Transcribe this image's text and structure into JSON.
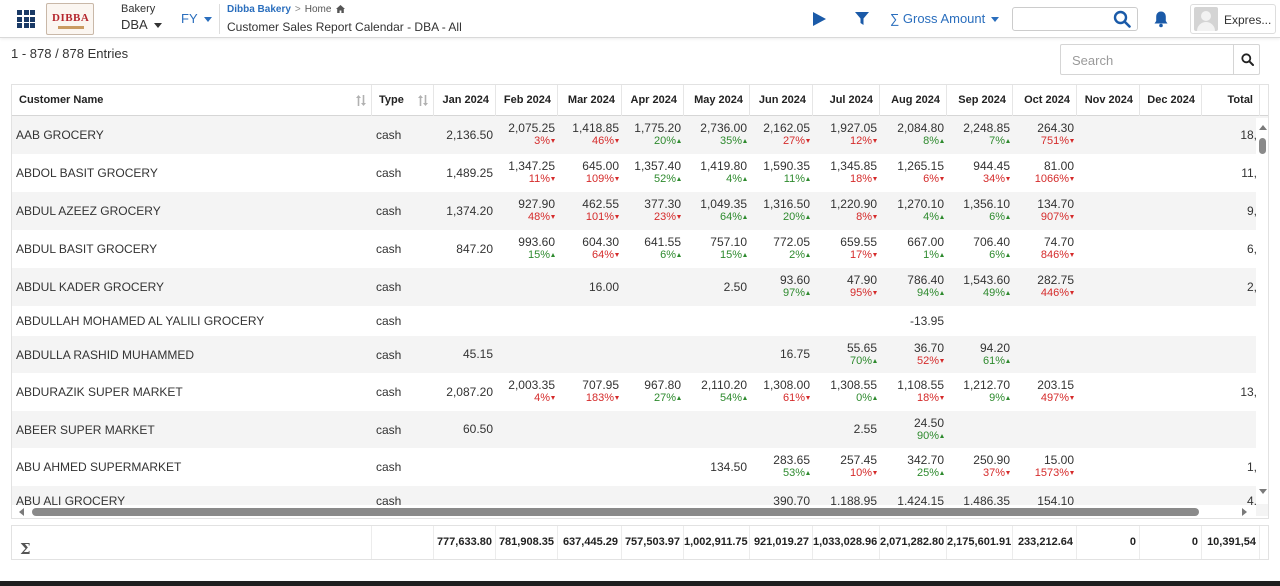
{
  "header": {
    "company_label": "Bakery",
    "company_value": "DBA",
    "period_label": "FY",
    "logo_text": "DIBBA",
    "breadcrumb": {
      "root": "Dibba Bakery",
      "separator": ">",
      "current": "Home"
    },
    "page_title": "Customer Sales Report Calendar - DBA - All",
    "measure_label": "∑ Gross Amount",
    "search_value": "",
    "user_name": "Expres..."
  },
  "toolbar": {
    "entries_text": "1 - 878 / 878 Entries",
    "search_placeholder": "Search"
  },
  "columns": [
    {
      "key": "name",
      "label": "Customer Name"
    },
    {
      "key": "type",
      "label": "Type"
    },
    {
      "key": "jan",
      "label": "Jan 2024"
    },
    {
      "key": "feb",
      "label": "Feb 2024"
    },
    {
      "key": "mar",
      "label": "Mar 2024"
    },
    {
      "key": "apr",
      "label": "Apr 2024"
    },
    {
      "key": "may",
      "label": "May 2024"
    },
    {
      "key": "jun",
      "label": "Jun 2024"
    },
    {
      "key": "jul",
      "label": "Jul 2024"
    },
    {
      "key": "aug",
      "label": "Aug 2024"
    },
    {
      "key": "sep",
      "label": "Sep 2024"
    },
    {
      "key": "oct",
      "label": "Oct 2024"
    },
    {
      "key": "nov",
      "label": "Nov 2024"
    },
    {
      "key": "dec",
      "label": "Dec 2024"
    },
    {
      "key": "total",
      "label": "Total"
    }
  ],
  "rows": [
    {
      "name": "AAB GROCERY",
      "type": "cash",
      "cells": [
        {
          "v": "2,136.50"
        },
        {
          "v": "2,075.25",
          "p": "3%",
          "d": "down"
        },
        {
          "v": "1,418.85",
          "p": "46%",
          "d": "down"
        },
        {
          "v": "1,775.20",
          "p": "20%",
          "d": "up"
        },
        {
          "v": "2,736.00",
          "p": "35%",
          "d": "up"
        },
        {
          "v": "2,162.05",
          "p": "27%",
          "d": "down"
        },
        {
          "v": "1,927.05",
          "p": "12%",
          "d": "down"
        },
        {
          "v": "2,084.80",
          "p": "8%",
          "d": "up"
        },
        {
          "v": "2,248.85",
          "p": "7%",
          "d": "up"
        },
        {
          "v": "264.30",
          "p": "751%",
          "d": "down"
        },
        {},
        {},
        {
          "v": "18,"
        }
      ]
    },
    {
      "name": "ABDOL BASIT GROCERY",
      "type": "cash",
      "cells": [
        {
          "v": "1,489.25"
        },
        {
          "v": "1,347.25",
          "p": "11%",
          "d": "down"
        },
        {
          "v": "645.00",
          "p": "109%",
          "d": "down"
        },
        {
          "v": "1,357.40",
          "p": "52%",
          "d": "up"
        },
        {
          "v": "1,419.80",
          "p": "4%",
          "d": "up"
        },
        {
          "v": "1,590.35",
          "p": "11%",
          "d": "up"
        },
        {
          "v": "1,345.85",
          "p": "18%",
          "d": "down"
        },
        {
          "v": "1,265.15",
          "p": "6%",
          "d": "down"
        },
        {
          "v": "944.45",
          "p": "34%",
          "d": "down"
        },
        {
          "v": "81.00",
          "p": "1066%",
          "d": "down"
        },
        {},
        {},
        {
          "v": "11,"
        }
      ]
    },
    {
      "name": "ABDUL AZEEZ GROCERY",
      "type": "cash",
      "cells": [
        {
          "v": "1,374.20"
        },
        {
          "v": "927.90",
          "p": "48%",
          "d": "down"
        },
        {
          "v": "462.55",
          "p": "101%",
          "d": "down"
        },
        {
          "v": "377.30",
          "p": "23%",
          "d": "down"
        },
        {
          "v": "1,049.35",
          "p": "64%",
          "d": "up"
        },
        {
          "v": "1,316.50",
          "p": "20%",
          "d": "up"
        },
        {
          "v": "1,220.90",
          "p": "8%",
          "d": "down"
        },
        {
          "v": "1,270.10",
          "p": "4%",
          "d": "up"
        },
        {
          "v": "1,356.10",
          "p": "6%",
          "d": "up"
        },
        {
          "v": "134.70",
          "p": "907%",
          "d": "down"
        },
        {},
        {},
        {
          "v": "9,"
        }
      ]
    },
    {
      "name": "ABDUL BASIT GROCERY",
      "type": "cash",
      "cells": [
        {
          "v": "847.20"
        },
        {
          "v": "993.60",
          "p": "15%",
          "d": "up"
        },
        {
          "v": "604.30",
          "p": "64%",
          "d": "down"
        },
        {
          "v": "641.55",
          "p": "6%",
          "d": "up"
        },
        {
          "v": "757.10",
          "p": "15%",
          "d": "up"
        },
        {
          "v": "772.05",
          "p": "2%",
          "d": "up"
        },
        {
          "v": "659.55",
          "p": "17%",
          "d": "down"
        },
        {
          "v": "667.00",
          "p": "1%",
          "d": "up"
        },
        {
          "v": "706.40",
          "p": "6%",
          "d": "up"
        },
        {
          "v": "74.70",
          "p": "846%",
          "d": "down"
        },
        {},
        {},
        {
          "v": "6,"
        }
      ]
    },
    {
      "name": "ABDUL KADER GROCERY",
      "type": "cash",
      "cells": [
        {},
        {},
        {
          "v": "16.00"
        },
        {},
        {
          "v": "2.50"
        },
        {
          "v": "93.60",
          "p": "97%",
          "d": "up"
        },
        {
          "v": "47.90",
          "p": "95%",
          "d": "down"
        },
        {
          "v": "786.40",
          "p": "94%",
          "d": "up"
        },
        {
          "v": "1,543.60",
          "p": "49%",
          "d": "up"
        },
        {
          "v": "282.75",
          "p": "446%",
          "d": "down"
        },
        {},
        {},
        {
          "v": "2,"
        }
      ]
    },
    {
      "name": "ABDULLAH MOHAMED AL YALILI GROCERY",
      "type": "cash",
      "cells": [
        {},
        {},
        {},
        {},
        {},
        {},
        {},
        {
          "v": "-13.95"
        },
        {},
        {},
        {},
        {},
        {}
      ]
    },
    {
      "name": "ABDULLA RASHID MUHAMMED",
      "type": "cash",
      "cells": [
        {
          "v": "45.15"
        },
        {},
        {},
        {},
        {},
        {
          "v": "16.75"
        },
        {
          "v": "55.65",
          "p": "70%",
          "d": "up"
        },
        {
          "v": "36.70",
          "p": "52%",
          "d": "down"
        },
        {
          "v": "94.20",
          "p": "61%",
          "d": "up"
        },
        {},
        {},
        {},
        {}
      ]
    },
    {
      "name": "ABDURAZIK SUPER MARKET",
      "type": "cash",
      "cells": [
        {
          "v": "2,087.20"
        },
        {
          "v": "2,003.35",
          "p": "4%",
          "d": "down"
        },
        {
          "v": "707.95",
          "p": "183%",
          "d": "down"
        },
        {
          "v": "967.80",
          "p": "27%",
          "d": "up"
        },
        {
          "v": "2,110.20",
          "p": "54%",
          "d": "up"
        },
        {
          "v": "1,308.00",
          "p": "61%",
          "d": "down"
        },
        {
          "v": "1,308.55",
          "p": "0%",
          "d": "up"
        },
        {
          "v": "1,108.55",
          "p": "18%",
          "d": "down"
        },
        {
          "v": "1,212.70",
          "p": "9%",
          "d": "up"
        },
        {
          "v": "203.15",
          "p": "497%",
          "d": "down"
        },
        {},
        {},
        {
          "v": "13,"
        }
      ]
    },
    {
      "name": "ABEER SUPER MARKET",
      "type": "cash",
      "cells": [
        {
          "v": "60.50"
        },
        {},
        {},
        {},
        {},
        {},
        {
          "v": "2.55"
        },
        {
          "v": "24.50",
          "p": "90%",
          "d": "up"
        },
        {},
        {},
        {},
        {},
        {}
      ]
    },
    {
      "name": "ABU AHMED SUPERMARKET",
      "type": "cash",
      "cells": [
        {},
        {},
        {},
        {},
        {
          "v": "134.50"
        },
        {
          "v": "283.65",
          "p": "53%",
          "d": "up"
        },
        {
          "v": "257.45",
          "p": "10%",
          "d": "down"
        },
        {
          "v": "342.70",
          "p": "25%",
          "d": "up"
        },
        {
          "v": "250.90",
          "p": "37%",
          "d": "down"
        },
        {
          "v": "15.00",
          "p": "1573%",
          "d": "down"
        },
        {},
        {},
        {
          "v": "1,"
        }
      ]
    },
    {
      "name": "ABU ALI GROCERY",
      "type": "cash",
      "cells": [
        {},
        {},
        {},
        {},
        {},
        {
          "v": "390.70"
        },
        {
          "v": "1,188.95"
        },
        {
          "v": "1,424.15"
        },
        {
          "v": "1,486.35"
        },
        {
          "v": "154.10"
        },
        {},
        {},
        {
          "v": "4,"
        }
      ]
    }
  ],
  "totals": {
    "sigma": "Σ",
    "values": [
      "777,633.80",
      "781,908.35",
      "637,445.29",
      "757,503.97",
      "1,002,911.75",
      "921,019.27",
      "1,033,028.96",
      "2,071,282.80",
      "2,175,601.91",
      "233,212.64",
      "0",
      "0",
      "10,391,54"
    ]
  },
  "colors": {
    "accent": "#2a6ebd",
    "up": "#2e8a2e",
    "down": "#d52b2b",
    "row_alt": "#f4f4f4"
  }
}
